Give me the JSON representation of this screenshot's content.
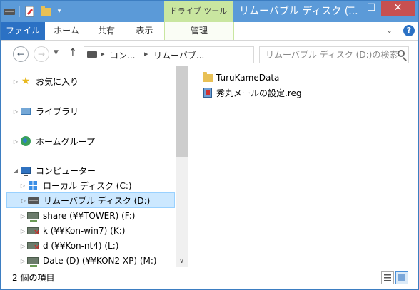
{
  "window": {
    "title": "リムーバブル ディスク (...",
    "context_tab_label": "ドライブ ツール",
    "minimize": "─",
    "maximize": "☐",
    "close": "✕"
  },
  "ribbon": {
    "tabs": [
      "ファイル",
      "ホーム",
      "共有",
      "表示",
      "管理"
    ],
    "expand_chevron": "⌄",
    "help": "?"
  },
  "navigation": {
    "back": "←",
    "forward": "→",
    "recent_dropdown": "▼",
    "up": "↑",
    "address_crumbs": [
      "コン...",
      "リムーバブ..."
    ],
    "crumb_separator": "▸",
    "address_dropdown": "⌄",
    "refresh": "⟳",
    "search_placeholder": "リムーバブル ディスク (D:)の検索"
  },
  "nav_pane": {
    "items": [
      {
        "label": "お気に入り",
        "icon": "star-icon",
        "expander": "▷"
      },
      {
        "label": "ライブラリ",
        "icon": "library-icon",
        "expander": "▷"
      },
      {
        "label": "ホームグループ",
        "icon": "homegroup-icon",
        "expander": "▷"
      },
      {
        "label": "コンピューター",
        "icon": "computer-icon",
        "expander": "◢"
      },
      {
        "label": "ローカル ディスク (C:)",
        "icon": "windows-drive-icon",
        "expander": "▷"
      },
      {
        "label": "リムーバブル ディスク (D:)",
        "icon": "removable-drive-icon",
        "expander": "▷",
        "selected": true
      },
      {
        "label": "share (¥¥TOWER) (F:)",
        "icon": "network-drive-icon",
        "expander": "▷"
      },
      {
        "label": "k (¥¥Kon-win7) (K:)",
        "icon": "disconnected-network-drive-icon",
        "expander": "▷"
      },
      {
        "label": "d (¥¥Kon-nt4) (L:)",
        "icon": "disconnected-network-drive-icon",
        "expander": "▷"
      },
      {
        "label": "Date (D) (¥¥KON2-XP) (M:)",
        "icon": "network-drive-icon",
        "expander": "▷"
      }
    ],
    "scroll_down": "∨"
  },
  "content": {
    "items": [
      {
        "name": "TuruKameData",
        "icon": "folder-icon"
      },
      {
        "name": "秀丸メールの設定.reg",
        "icon": "registry-file-icon"
      }
    ]
  },
  "status_bar": {
    "item_count": "2 個の項目"
  },
  "colors": {
    "titlebar": "#5b9ad8",
    "file_tab": "#2b71c4",
    "context_tab": "#c9e6a0",
    "close_button": "#c75050",
    "selection": "#cce8ff"
  }
}
